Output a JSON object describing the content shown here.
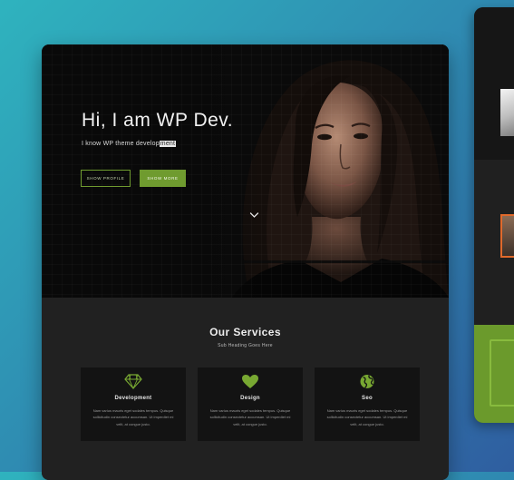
{
  "hero": {
    "title": "Hi, I am WP Dev.",
    "subtitle_prefix": "I know WP theme develop",
    "subtitle_selected": "ment",
    "buttons": {
      "show_profile": "Show Profile",
      "show_more": "Show More"
    },
    "scroll_icon": "chevron-down-icon"
  },
  "services": {
    "title": "Our Services",
    "subheading": "Sub Heading Goes Here",
    "items": [
      {
        "name": "Development",
        "icon": "diamond-icon",
        "description": "Nam varius mauris eget sodales tempus. Quisque sollicitudin consectetur accumsan. Ut imperdiet mi velit, at congue justo."
      },
      {
        "name": "Design",
        "icon": "heart-icon",
        "description": "Nam varius mauris eget sodales tempus. Quisque sollicitudin consectetur accumsan. Ut imperdiet mi velit, at congue justo."
      },
      {
        "name": "Seo",
        "icon": "globe-icon",
        "description": "Nam varius mauris eget sodales tempus. Quisque sollicitudin consectetur accumsan. Ut imperdiet mi velit, at congue justo."
      }
    ]
  },
  "colors": {
    "accent": "#6f9b2f",
    "hero_background": "#090909",
    "section_background": "#212121",
    "card_background": "#131313",
    "page_gradient": [
      "#2fb3be",
      "#2f5ea0"
    ],
    "side_card_green": "#6b9a2c",
    "side_card_orange": "#e0692b"
  }
}
